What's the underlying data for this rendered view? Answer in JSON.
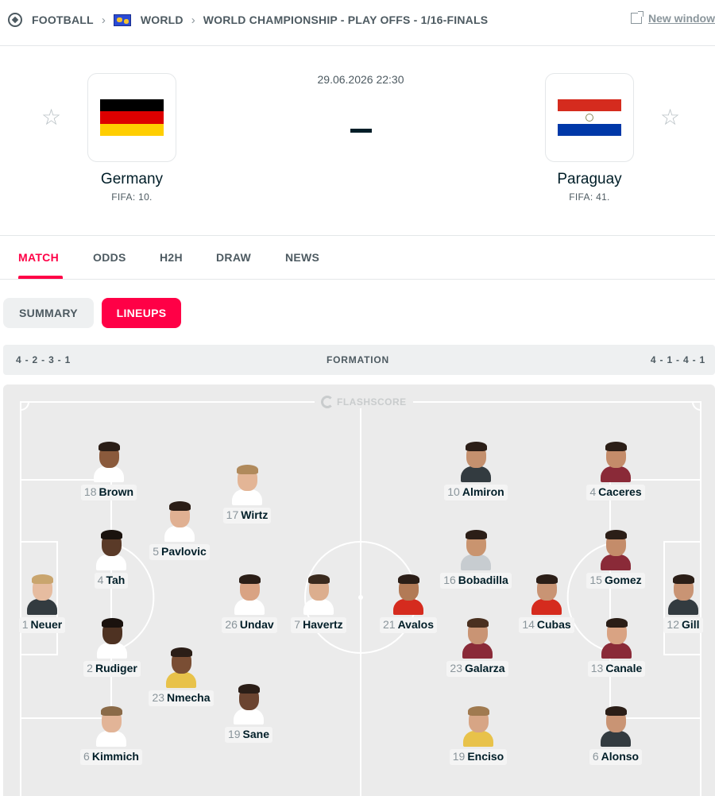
{
  "breadcrumb": {
    "sport": "FOOTBALL",
    "region": "WORLD",
    "competition": "WORLD CHAMPIONSHIP - PLAY OFFS - 1/16-FINALS",
    "new_window": "New window"
  },
  "match": {
    "datetime": "29.06.2026 22:30",
    "home": {
      "name": "Germany",
      "rank": "FIFA: 10.",
      "flag_colors": [
        "#000000",
        "#dd0000",
        "#ffce00"
      ]
    },
    "away": {
      "name": "Paraguay",
      "rank": "FIFA: 41.",
      "flag_colors": [
        "#d52b1e",
        "#ffffff",
        "#0038a8"
      ]
    }
  },
  "tabs": [
    "MATCH",
    "ODDS",
    "H2H",
    "DRAW",
    "NEWS"
  ],
  "active_tab": "MATCH",
  "subtabs": {
    "summary": "SUMMARY",
    "lineups": "LINEUPS"
  },
  "formation": {
    "home": "4 - 2 - 3 - 1",
    "label": "FORMATION",
    "away": "4 - 1 - 4 - 1"
  },
  "pitch_brand": "FLASHSCORE",
  "lineups": {
    "home_kit": "#ffffff",
    "away_kit": "#d52b1e",
    "home": [
      {
        "num": "18",
        "name": "Brown"
      },
      {
        "num": "17",
        "name": "Wirtz"
      },
      {
        "num": "5",
        "name": "Pavlovic"
      },
      {
        "num": "4",
        "name": "Tah"
      },
      {
        "num": "1",
        "name": "Neuer"
      },
      {
        "num": "26",
        "name": "Undav"
      },
      {
        "num": "7",
        "name": "Havertz"
      },
      {
        "num": "2",
        "name": "Rudiger"
      },
      {
        "num": "23",
        "name": "Nmecha"
      },
      {
        "num": "19",
        "name": "Sane"
      },
      {
        "num": "6",
        "name": "Kimmich"
      }
    ],
    "away": [
      {
        "num": "10",
        "name": "Almiron"
      },
      {
        "num": "4",
        "name": "Caceres"
      },
      {
        "num": "16",
        "name": "Bobadilla"
      },
      {
        "num": "15",
        "name": "Gomez"
      },
      {
        "num": "21",
        "name": "Avalos"
      },
      {
        "num": "14",
        "name": "Cubas"
      },
      {
        "num": "12",
        "name": "Gill"
      },
      {
        "num": "23",
        "name": "Galarza"
      },
      {
        "num": "13",
        "name": "Canale"
      },
      {
        "num": "19",
        "name": "Enciso"
      },
      {
        "num": "6",
        "name": "Alonso"
      }
    ]
  }
}
